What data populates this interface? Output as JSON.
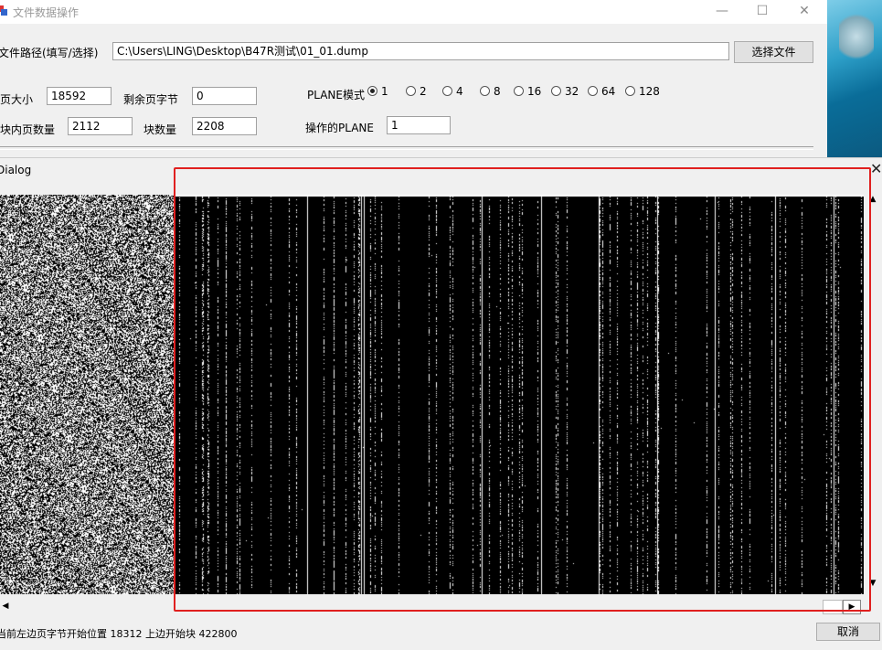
{
  "window": {
    "title": "文件数据操作",
    "minimize": "—",
    "maximize": "☐",
    "close": "✕"
  },
  "form": {
    "path_label": "文件路径(填写/选择)",
    "path_value": "C:\\Users\\LING\\Desktop\\B47R测试\\01_01.dump",
    "choose_button": "选择文件",
    "page_size_label": "页大小",
    "page_size_value": "18592",
    "remaining_label": "剩余页字节",
    "remaining_value": "0",
    "pages_per_block_label": "块内页数量",
    "pages_per_block_value": "2112",
    "block_count_label": "块数量",
    "block_count_value": "2208",
    "plane_mode_label": "PLANE模式",
    "plane_options": [
      "1",
      "2",
      "4",
      "8",
      "16",
      "32",
      "64",
      "128"
    ],
    "plane_selected": "1",
    "operate_plane_label": "操作的PLANE",
    "operate_plane_value": "1"
  },
  "dialog": {
    "title": "Dialog",
    "close": "✕",
    "status": "当前左边页字节开始位置 18312 上边开始块 422800",
    "cancel_button": "取消",
    "scroll_up": "▲",
    "scroll_down": "▼",
    "scroll_left": "◀",
    "scroll_right": "▶"
  },
  "colors": {
    "highlight_box": "#e0201f"
  }
}
